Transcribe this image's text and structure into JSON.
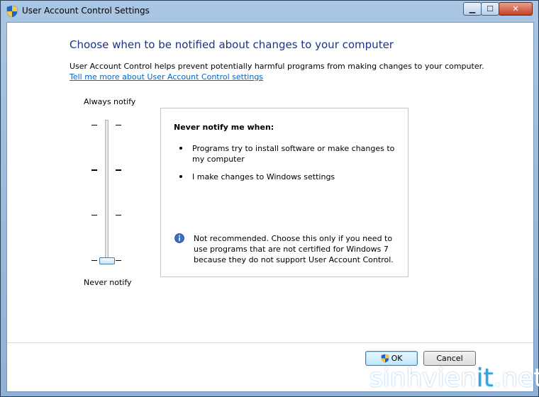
{
  "window": {
    "title": "User Account Control Settings",
    "controls": {
      "minimize": "▁",
      "maximize": "☐",
      "close": "✕"
    }
  },
  "main": {
    "heading": "Choose when to be notified about changes to your computer",
    "description": "User Account Control helps prevent potentially harmful programs from making changes to your computer.",
    "link": "Tell me more about User Account Control settings"
  },
  "slider": {
    "top_label": "Always notify",
    "bottom_label": "Never notify",
    "levels": 4,
    "selected_level": 1
  },
  "info": {
    "heading": "Never notify me when:",
    "bullets": [
      "Programs try to install software or make changes to my computer",
      "I make changes to Windows settings"
    ],
    "note": "Not recommended. Choose this only if you need to use programs that are not certified for Windows 7 because they do not support User Account Control."
  },
  "buttons": {
    "ok": "OK",
    "cancel": "Cancel"
  },
  "watermark": {
    "prefix": "sinhvien",
    "accent": "it",
    "suffix": ".net"
  },
  "icons": {
    "title": "uac-shield-icon",
    "note": "info-icon",
    "ok": "uac-shield-icon"
  },
  "colors": {
    "heading": "#1e3287",
    "link": "#0066cc",
    "accent": "#3c7fb1"
  }
}
